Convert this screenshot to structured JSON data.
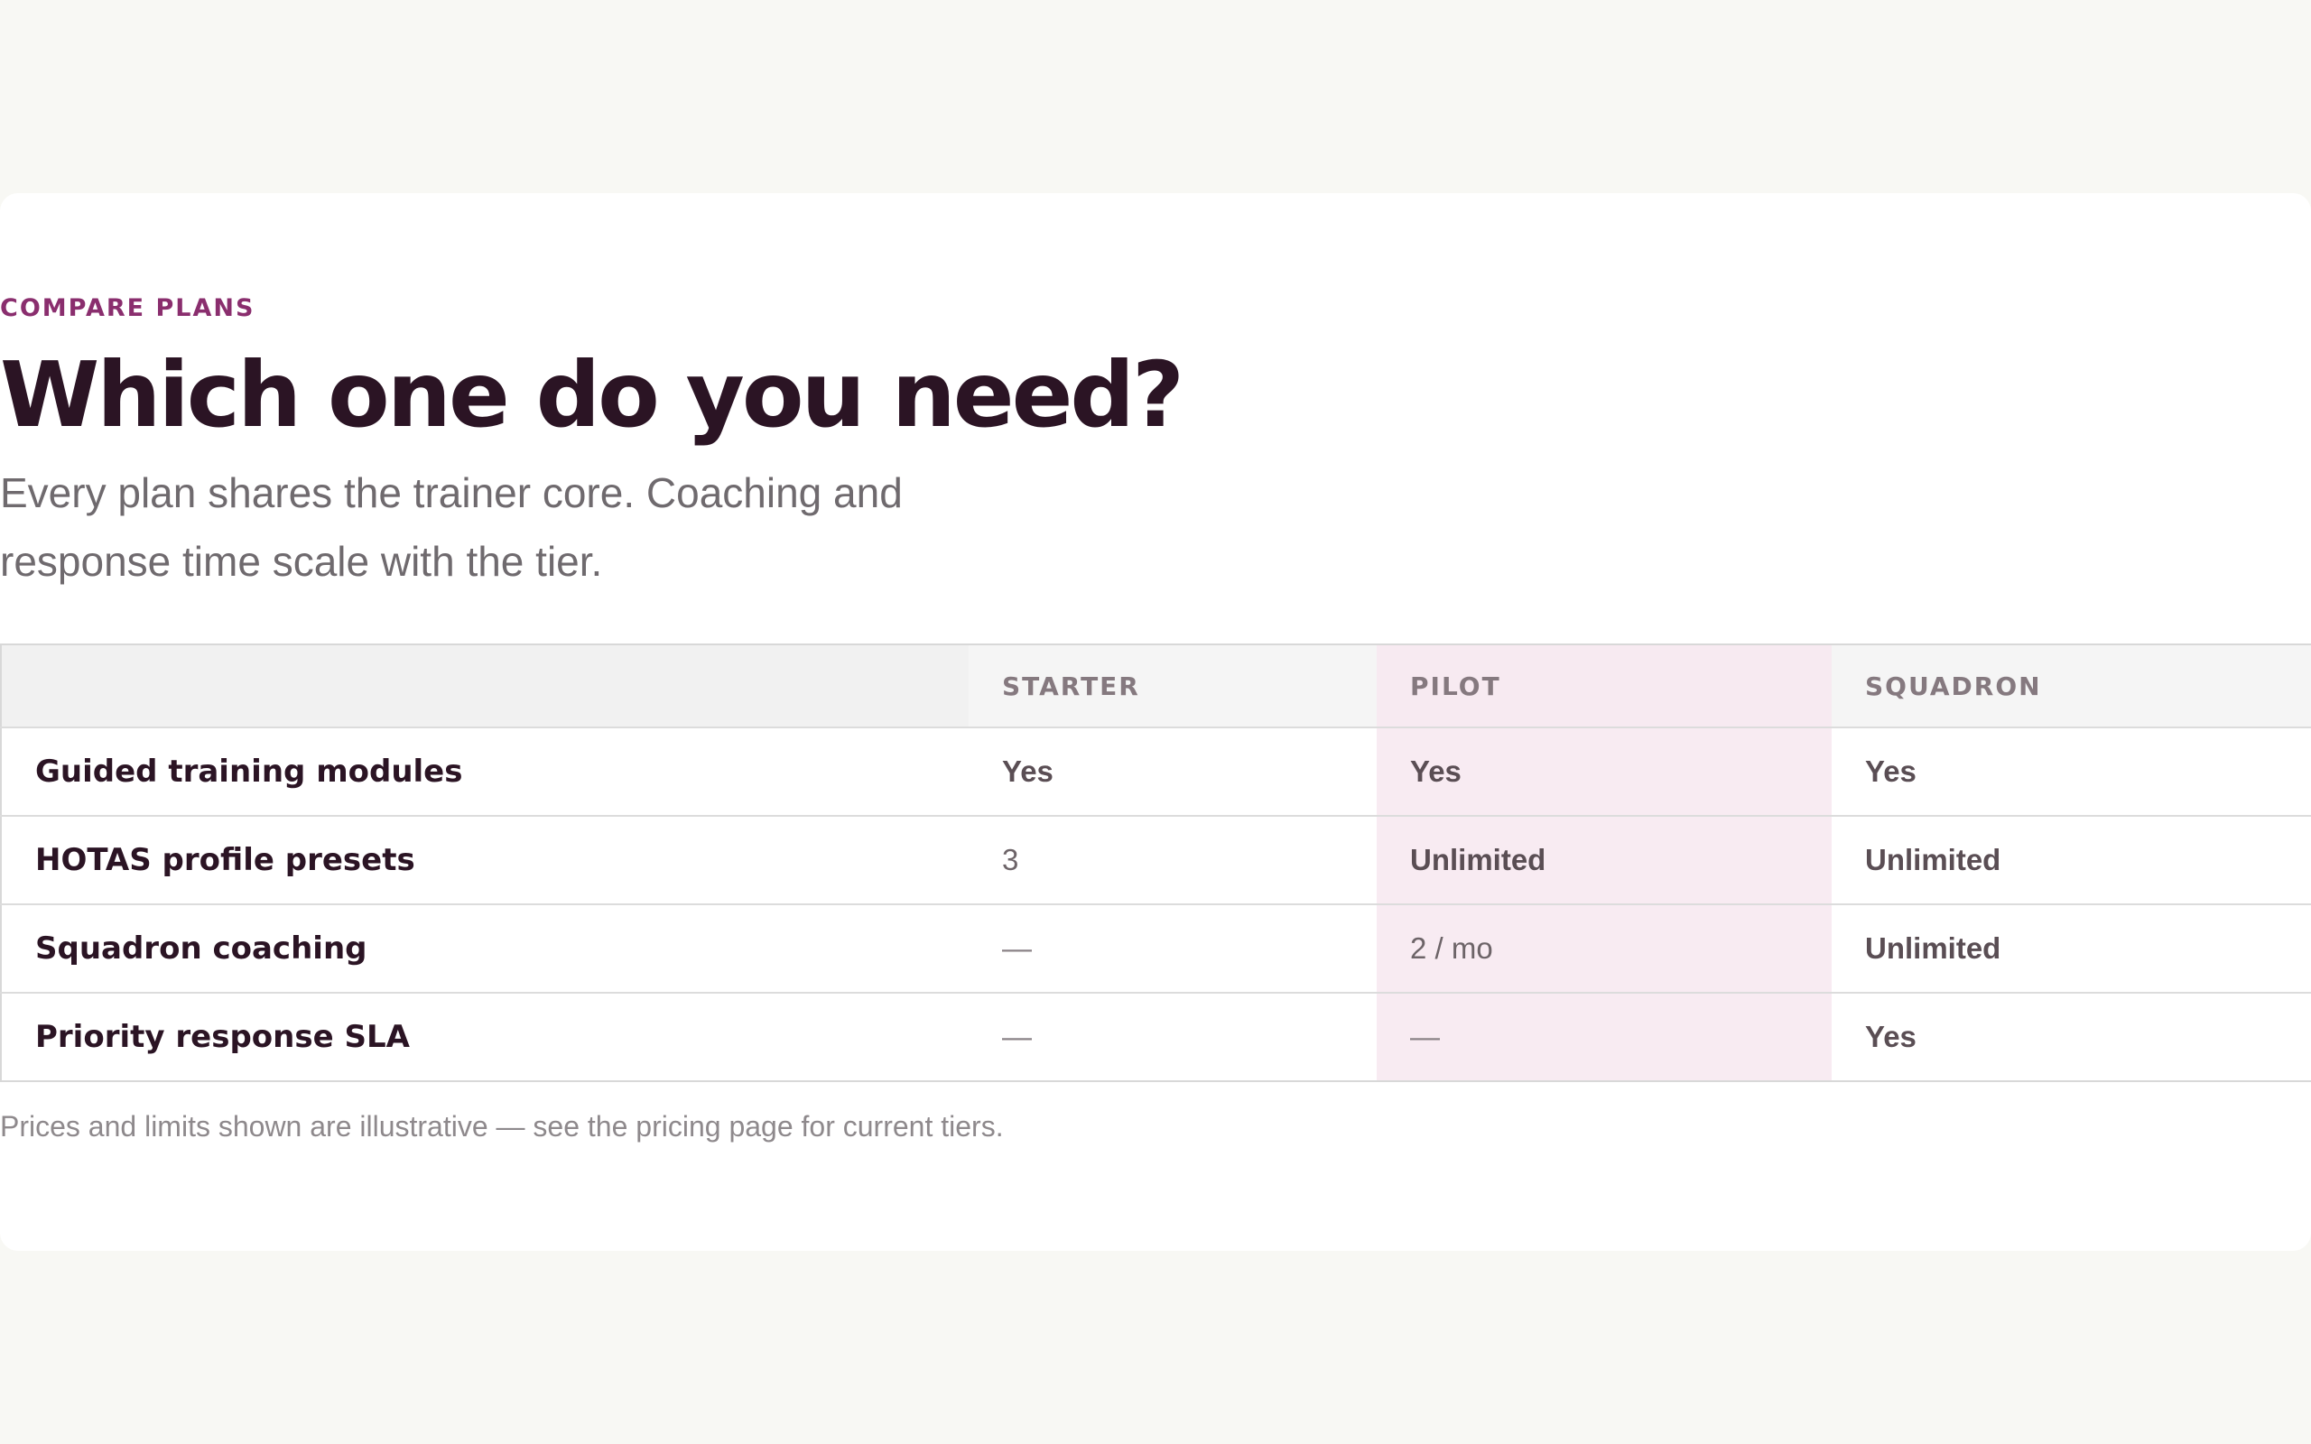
{
  "section": {
    "eyebrow": "COMPARE PLANS",
    "title": "Which one do you need?",
    "subtitle": "Every plan shares the trainer core. Coaching and response time scale with the tier.",
    "footnote": "Prices and limits shown are illustrative — see the pricing page for current tiers."
  },
  "table": {
    "columns": [
      "",
      "STARTER",
      "PILOT",
      "SQUADRON"
    ],
    "highlighted_column": "PILOT",
    "rows": [
      {
        "feature": "Guided training modules",
        "starter": "Yes",
        "pilot": "Yes",
        "squadron": "Yes"
      },
      {
        "feature": "HOTAS profile presets",
        "starter": "3",
        "pilot": "Unlimited",
        "squadron": "Unlimited"
      },
      {
        "feature": "Squadron coaching",
        "starter": "—",
        "pilot": "2 / mo",
        "squadron": "Unlimited"
      },
      {
        "feature": "Priority response SLA",
        "starter": "—",
        "pilot": "—",
        "squadron": "Yes"
      }
    ]
  },
  "colors": {
    "accent": "#8a2e6e",
    "heading": "#2b1424",
    "highlight_column_bg": "#f8ebf2",
    "page_bg": "#f8f8f4"
  }
}
